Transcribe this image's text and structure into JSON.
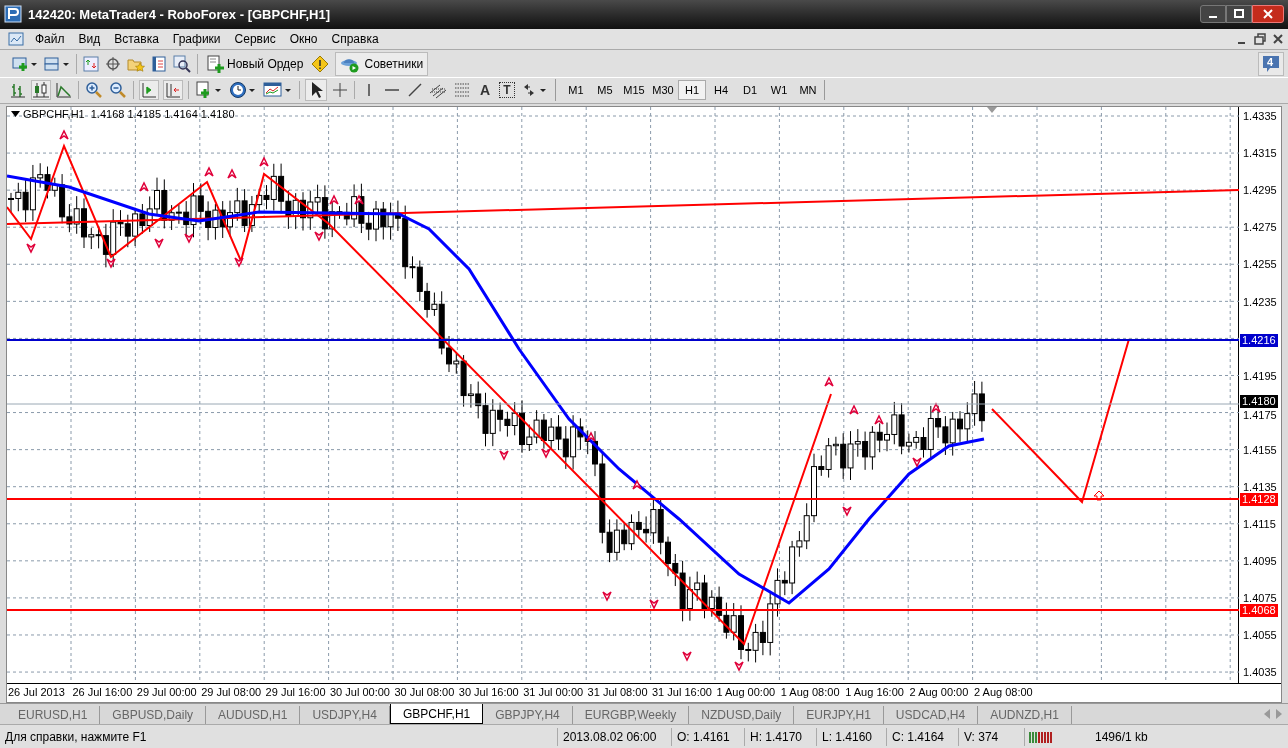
{
  "window": {
    "title": "142420: MetaTrader4 - RoboForex - [GBPCHF,H1]"
  },
  "menu": [
    "Файл",
    "Вид",
    "Вставка",
    "Графики",
    "Сервис",
    "Окно",
    "Справка"
  ],
  "toolbar": {
    "new_order": "Новый Ордер",
    "expert_advisors": "Советники",
    "text_tool": "A",
    "label_tool": "T"
  },
  "notifications": {
    "count": "4"
  },
  "timeframes": [
    {
      "label": "M1",
      "selected": false
    },
    {
      "label": "M5",
      "selected": false
    },
    {
      "label": "M15",
      "selected": false
    },
    {
      "label": "M30",
      "selected": false
    },
    {
      "label": "H1",
      "selected": true
    },
    {
      "label": "H4",
      "selected": false
    },
    {
      "label": "D1",
      "selected": false
    },
    {
      "label": "W1",
      "selected": false
    },
    {
      "label": "MN",
      "selected": false
    }
  ],
  "chart": {
    "symbol": "GBPCHF,H1",
    "ohlc": "1.4168 1.4185 1.4164 1.4180",
    "price_axis": [
      "1.4335",
      "1.4315",
      "1.4295",
      "1.4275",
      "1.4255",
      "1.4235",
      "1.4195",
      "1.4175",
      "1.4155",
      "1.4135",
      "1.4115",
      "1.4095",
      "1.4075",
      "1.4055",
      "1.4035"
    ],
    "price_labels": [
      {
        "text": "1.4216",
        "color": "#0000cc"
      },
      {
        "text": "1.4180",
        "color": "#000000"
      },
      {
        "text": "1.4128",
        "color": "#ff0000"
      },
      {
        "text": "1.4068",
        "color": "#ff0000"
      }
    ],
    "time_axis": [
      "26 Jul 2013",
      "26 Jul 16:00",
      "29 Jul 00:00",
      "29 Jul 08:00",
      "29 Jul 16:00",
      "30 Jul 00:00",
      "30 Jul 08:00",
      "30 Jul 16:00",
      "31 Jul 00:00",
      "31 Jul 08:00",
      "31 Jul 16:00",
      "1 Aug 00:00",
      "1 Aug 08:00",
      "1 Aug 16:00",
      "2 Aug 00:00",
      "2 Aug 08:00"
    ]
  },
  "chart_tabs": [
    {
      "label": "EURUSD,H1",
      "selected": false
    },
    {
      "label": "GBPUSD,Daily",
      "selected": false
    },
    {
      "label": "AUDUSD,H1",
      "selected": false
    },
    {
      "label": "USDJPY,H4",
      "selected": false
    },
    {
      "label": "GBPCHF,H1",
      "selected": true
    },
    {
      "label": "GBPJPY,H4",
      "selected": false
    },
    {
      "label": "EURGBP,Weekly",
      "selected": false
    },
    {
      "label": "NZDUSD,Daily",
      "selected": false
    },
    {
      "label": "EURJPY,H1",
      "selected": false
    },
    {
      "label": "USDCAD,H4",
      "selected": false
    },
    {
      "label": "AUDNZD,H1",
      "selected": false
    }
  ],
  "status_bar": {
    "help": "Для справки, нажмите F1",
    "datetime": "2013.08.02 06:00",
    "open": "O: 1.4161",
    "high": "H: 1.4170",
    "low": "L: 1.4160",
    "close": "C: 1.4164",
    "volume": "V: 374",
    "traffic": "1496/1 kb"
  }
}
